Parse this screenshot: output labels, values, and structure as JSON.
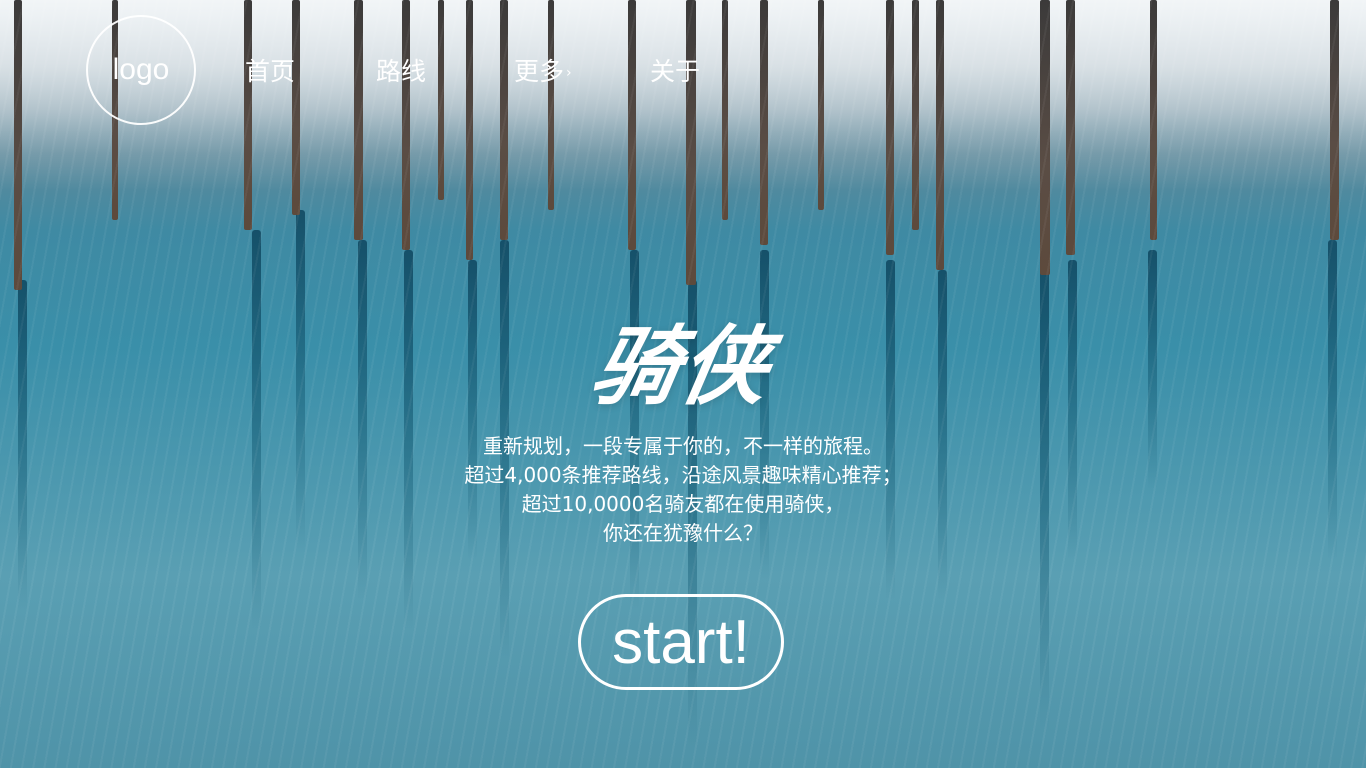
{
  "logo": {
    "text": "logo"
  },
  "nav": {
    "items": [
      {
        "label": "首页"
      },
      {
        "label": "路线"
      },
      {
        "label": "更多"
      },
      {
        "label": "关于"
      }
    ]
  },
  "hero": {
    "title": "骑侠",
    "lines": [
      "重新规划，一段专属于你的，不一样的旅程。",
      "超过4,000条推荐路线，沿途风景趣味精心推荐；",
      "超过10,0000名骑友都在使用骑侠，",
      "你还在犹豫什么？"
    ],
    "cta_label": "start!"
  },
  "colors": {
    "text": "#ffffff",
    "water": "#3a8fa9",
    "snow": "#f0f4f6"
  },
  "icons": {
    "nav_more": "chevron-right-icon"
  }
}
